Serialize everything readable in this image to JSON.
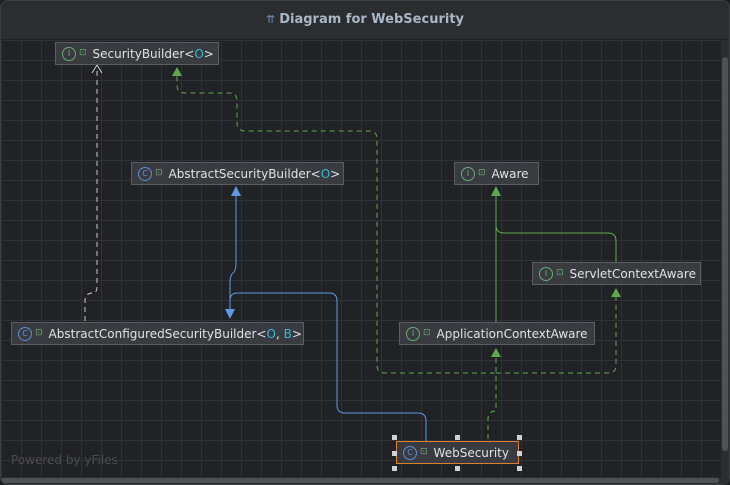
{
  "window": {
    "title": "Diagram for WebSecurity"
  },
  "nodes": {
    "security_builder": {
      "name": "SecurityBuilder",
      "generic_open": "<",
      "generic": "O",
      "generic_close": ">",
      "kind": "interface"
    },
    "abstract_security_builder": {
      "name": "AbstractSecurityBuilder",
      "generic_open": "<",
      "generic": "O",
      "generic_close": ">",
      "kind": "abstract-class"
    },
    "abstract_configured_security_builder": {
      "name": "AbstractConfiguredSecurityBuilder",
      "generic_open": "<",
      "generic": "O",
      "generic_sep": ", ",
      "generic2": "B",
      "generic_close": ">",
      "kind": "abstract-class"
    },
    "aware": {
      "name": "Aware",
      "kind": "interface"
    },
    "servlet_context_aware": {
      "name": "ServletContextAware",
      "kind": "interface"
    },
    "application_context_aware": {
      "name": "ApplicationContextAware",
      "kind": "interface"
    },
    "web_security": {
      "name": "WebSecurity",
      "kind": "class",
      "selected": true
    }
  },
  "icons": {
    "interface": "interface-icon",
    "class": "class-icon",
    "visibility": "public-lock-icon"
  },
  "colors": {
    "inherit_edge": "#5c9be6",
    "implement_edge": "#5fa84f",
    "dependency_edge": "#c9c9c9",
    "selection_border": "#d9822b",
    "generic_param": "#2fbcd1"
  },
  "watermark": "Powered by yFiles"
}
